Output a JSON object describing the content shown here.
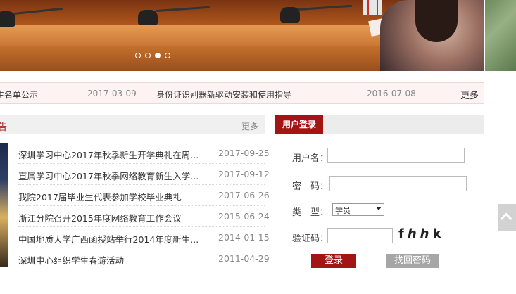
{
  "banner": {
    "slide_count": 4,
    "active_slide": 3
  },
  "notice": {
    "items": [
      {
        "title": "生名单公示",
        "date": "2017-03-09"
      },
      {
        "title": "身份证识别器新驱动安装和使用指导",
        "date": "2016-07-08"
      }
    ],
    "more_label": "更多"
  },
  "news": {
    "title": "告",
    "more_label": "更多",
    "items": [
      {
        "title": "深圳学习中心2017年秋季新生开学典礼在周...",
        "date": "2017-09-25"
      },
      {
        "title": "直属学习中心2017年秋季网络教育新生入学...",
        "date": "2017-09-12"
      },
      {
        "title": "我院2017届毕业生代表参加学校毕业典礼",
        "date": "2017-06-26"
      },
      {
        "title": "浙江分院召开2015年度网络教育工作会议",
        "date": "2015-06-24"
      },
      {
        "title": "中国地质大学广西函授站举行2014年度新生...",
        "date": "2014-01-15"
      },
      {
        "title": "深圳中心组织学生春游活动",
        "date": "2011-04-29"
      }
    ]
  },
  "login": {
    "tab_label": "用户登录",
    "username_label": "用户名：",
    "password_label": "密　码：",
    "type_label": "类　型：",
    "type_selected": "学员",
    "captcha_label": "验证码：",
    "captcha_chars": [
      "f",
      "h",
      "h",
      "k"
    ],
    "login_button": "登录",
    "find_password_button": "找回密码"
  },
  "colors": {
    "brand_red": "#a31414",
    "notice_bg": "#fdf3f3",
    "muted_text": "#888888"
  }
}
